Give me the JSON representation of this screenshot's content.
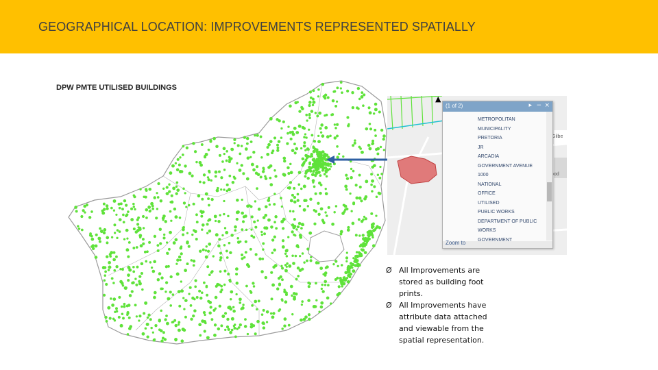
{
  "header": {
    "title": "GEOGRAPHICAL LOCATION: IMPROVEMENTS REPRESENTED SPATIALLY"
  },
  "map": {
    "title": "DPW PMTE UTILISED BUILDINGS",
    "point_color": "#5fe23a",
    "boundary_color": "#a0a0a0",
    "arrow_color": "#2e5fa3"
  },
  "inset": {
    "popup": {
      "nav": "(1 of 2)",
      "items": [
        "METROPOLITAN",
        "MUNICIPALITY",
        "PRETORIA",
        "JR",
        "ARCADIA",
        "GOVERNMENT AVENUE",
        "1000",
        "NATIONAL",
        "OFFICE",
        "UTILISED",
        "PUBLIC WORKS",
        "DEPARTMENT OF PUBLIC",
        "WORKS",
        "GOVERNMENT"
      ],
      "zoom_link": "Zoom to"
    },
    "street_labels": [
      "Gilbe",
      "wood"
    ]
  },
  "bullets": {
    "marker": "Ø",
    "items": [
      "All Improvements are stored as building foot prints.",
      "All Improvements have attribute data attached and viewable from the spatial representation."
    ]
  }
}
